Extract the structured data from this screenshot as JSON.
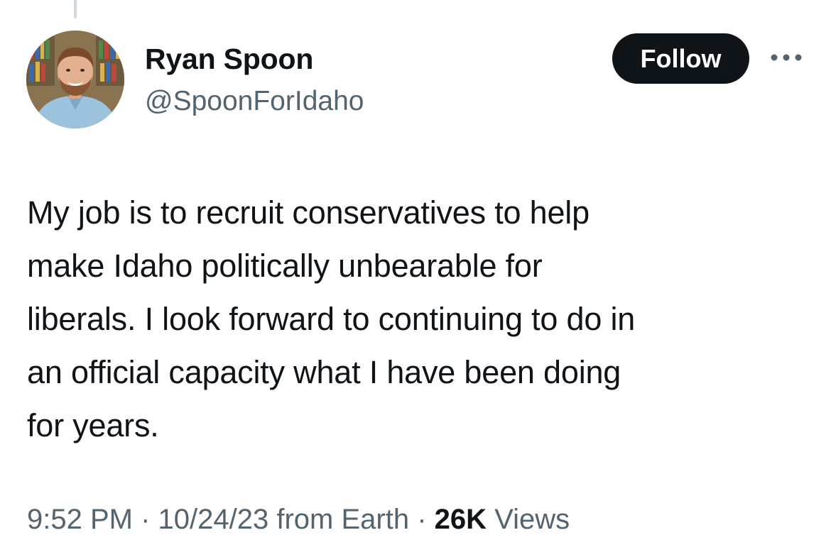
{
  "author": {
    "display_name": "Ryan Spoon",
    "handle": "@SpoonForIdaho",
    "avatar_icon": "profile-photo"
  },
  "actions": {
    "follow_label": "Follow",
    "more_icon": "more-horizontal-icon"
  },
  "tweet": {
    "lines": [
      "My job is to recruit conservatives to help",
      "make Idaho politically unbearable for",
      "liberals. I look forward to continuing to do in",
      "an official capacity what I have been doing",
      "for years."
    ]
  },
  "meta": {
    "time": "9:52 PM",
    "separator": "·",
    "date": "10/24/23",
    "source": "from Earth",
    "views_count": "26K",
    "views_label": "Views"
  },
  "colors": {
    "text": "#0f1419",
    "secondary": "#536471",
    "button_bg": "#0f1419",
    "thread_line": "#cfd9de"
  }
}
